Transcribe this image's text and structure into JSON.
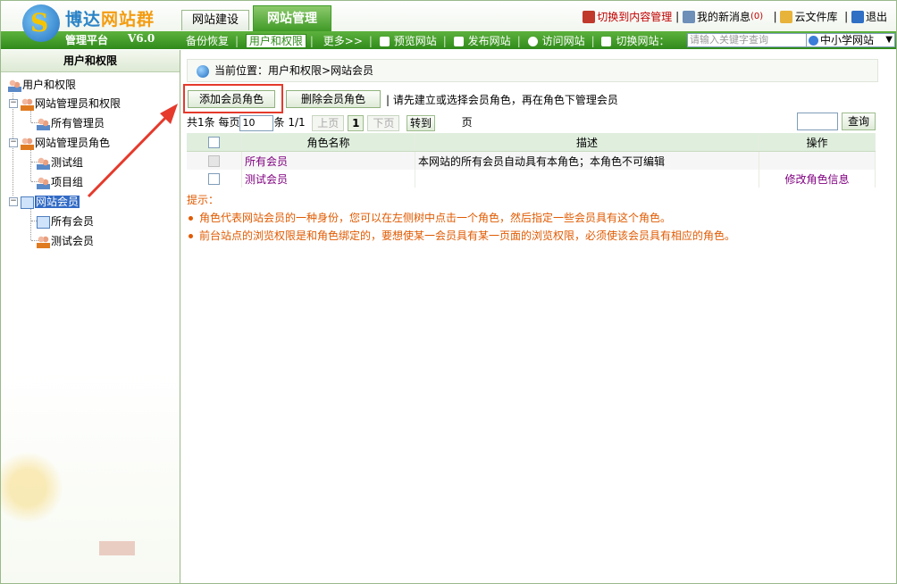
{
  "brand": {
    "name_part1": "博达",
    "name_part2": "网站群",
    "platform": "管理平台",
    "version": "V6.0"
  },
  "tabs": [
    {
      "label": "网站建设",
      "active": false
    },
    {
      "label": "网站管理",
      "active": true
    }
  ],
  "toplinks": {
    "switch_content": "切换到内容管理",
    "messages": "我的新消息",
    "message_count": "(0)",
    "cloud": "云文件库",
    "logout": "退出",
    "sep": "|"
  },
  "menu": {
    "items": [
      "备份恢复",
      "用户和权限",
      "更多>>",
      "预览网站",
      "发布网站",
      "访问网站",
      "切换网站："
    ],
    "current_index": 1,
    "search_placeholder": "请输入关键字查询",
    "site_select": "中小学网站"
  },
  "sidebar": {
    "title": "用户和权限",
    "tree": {
      "root": "用户和权限",
      "admins": "网站管理员和权限",
      "all_admins": "所有管理员",
      "admin_roles": "网站管理员角色",
      "test_group": "测试组",
      "project_group": "项目组",
      "members": "网站会员",
      "all_members": "所有会员",
      "test_members": "测试会员"
    }
  },
  "content": {
    "breadcrumb": "当前位置：用户和权限>网站会员",
    "buttons": {
      "add_role": "添加会员角色",
      "delete_role": "删除会员角色"
    },
    "hint": "| 请先建立或选择会员角色，再在角色下管理会员",
    "pager": {
      "total_label": "共1条",
      "per_page_label": "每页",
      "per_page_value": "10",
      "items_label": "条",
      "page_info": "1/1",
      "prev": "上页",
      "current": "1",
      "next": "下页",
      "goto": "转到",
      "page_unit": "页"
    },
    "search_button": "查询",
    "table": {
      "headers": [
        "",
        "角色名称",
        "描述",
        "操作"
      ],
      "rows": [
        {
          "name": "所有会员",
          "description": "本网站的所有会员自动具有本角色；本角色不可编辑",
          "action": ""
        },
        {
          "name": "测试会员",
          "description": "",
          "action": "修改角色信息"
        }
      ]
    },
    "tips": {
      "title": "提示：",
      "items": [
        "角色代表网站会员的一种身份，您可以在左侧树中点击一个角色，然后指定一些会员具有这个角色。",
        "前台站点的浏览权限是和角色绑定的，要想使某一会员具有某一页面的浏览权限，必须使该会员具有相应的角色。"
      ]
    }
  },
  "colors": {
    "brand_green": "#3f9a26",
    "annotation_red": "#e53a2c",
    "tip_orange": "#e05a00",
    "link_purple": "#800080"
  }
}
